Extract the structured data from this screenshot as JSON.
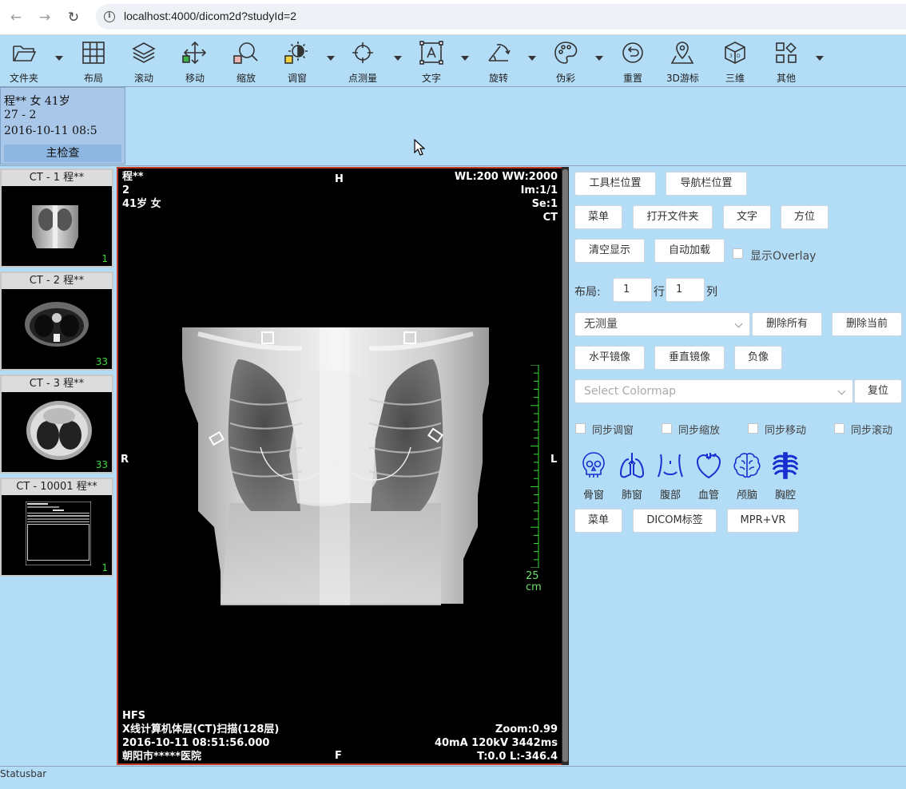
{
  "browser": {
    "url": "localhost:4000/dicom2d?studyId=2",
    "back_icon": "arrow-left",
    "forward_icon": "arrow-right",
    "reload_icon": "reload"
  },
  "toolbar": {
    "items": [
      {
        "label": "文件夹",
        "icon": "folder-open",
        "dropdown": true
      },
      {
        "label": "布局",
        "icon": "grid"
      },
      {
        "label": "滚动",
        "icon": "layers"
      },
      {
        "label": "移动",
        "icon": "move-arrows"
      },
      {
        "label": "缩放",
        "icon": "zoom"
      },
      {
        "label": "调窗",
        "icon": "window-level",
        "dropdown": true
      },
      {
        "label": "点测量",
        "icon": "crosshair",
        "dropdown": true
      },
      {
        "label": "文字",
        "icon": "text-box",
        "dropdown": true
      },
      {
        "label": "旋转",
        "icon": "rotate-angle",
        "dropdown": true
      },
      {
        "label": "伪彩",
        "icon": "palette",
        "dropdown": true
      },
      {
        "label": "重置",
        "icon": "reset"
      },
      {
        "label": "3D游标",
        "icon": "map-pin"
      },
      {
        "label": "三维",
        "icon": "3d-cube"
      },
      {
        "label": "其他",
        "icon": "apps",
        "dropdown": true
      }
    ]
  },
  "study": {
    "name_line": "程** 女  41岁",
    "id_line": "27 - 2",
    "datetime_line": "2016-10-11 08:5",
    "main_label": "主检查"
  },
  "series": [
    {
      "title": "CT - 1 程**",
      "count": "1"
    },
    {
      "title": "CT - 2 程**",
      "count": "33"
    },
    {
      "title": "CT - 3 程**",
      "count": "33"
    },
    {
      "title": "CT - 10001 程**",
      "count": "1"
    }
  ],
  "viewer": {
    "top_left": [
      "程**",
      "2",
      "41岁 女"
    ],
    "top_right": [
      "WL:200 WW:2000",
      "Im:1/1",
      "Se:1",
      "CT"
    ],
    "bottom_left": [
      "HFS",
      "X线计算机体层(CT)扫描(128层)",
      "2016-10-11 08:51:56.000",
      "朝阳市*****医院"
    ],
    "bottom_right": [
      "Zoom:0.99",
      "40mA 120kV 3442ms",
      "T:0.0 L:-346.4"
    ],
    "orient_top": "H",
    "orient_bottom": "F",
    "orient_left": "R",
    "orient_right": "L",
    "ruler_value": "25",
    "ruler_unit": "cm",
    "ruler_color": "#3cdc3c",
    "border_color": "#c0392b"
  },
  "panel": {
    "buttons_row1": [
      "工具栏位置",
      "导航栏位置"
    ],
    "buttons_row2": [
      "菜单",
      "打开文件夹",
      "文字",
      "方位"
    ],
    "buttons_row3": [
      "清空显示",
      "自动加载"
    ],
    "overlay_label": "显示Overlay",
    "layout_label": "布局:",
    "rows_value": "1",
    "rows_unit": "行",
    "cols_value": "1",
    "cols_unit": "列",
    "measure_select": "无测量",
    "delete_all": "删除所有",
    "delete_current": "删除当前",
    "buttons_row6": [
      "水平镜像",
      "垂直镜像",
      "负像"
    ],
    "colormap_placeholder": "Select Colormap",
    "reset_label": "复位",
    "sync": [
      "同步调窗",
      "同步缩放",
      "同步移动",
      "同步滚动"
    ],
    "presets": [
      {
        "label": "骨窗",
        "icon": "skull"
      },
      {
        "label": "肺窗",
        "icon": "lungs"
      },
      {
        "label": "腹部",
        "icon": "abdomen"
      },
      {
        "label": "血管",
        "icon": "heart"
      },
      {
        "label": "颅脑",
        "icon": "brain"
      },
      {
        "label": "胸腔",
        "icon": "ribcage"
      }
    ],
    "preset_color": "#1a2fd0",
    "buttons_last": [
      "菜单",
      "DICOM标签",
      "MPR+VR"
    ]
  },
  "statusbar": "Statusbar"
}
